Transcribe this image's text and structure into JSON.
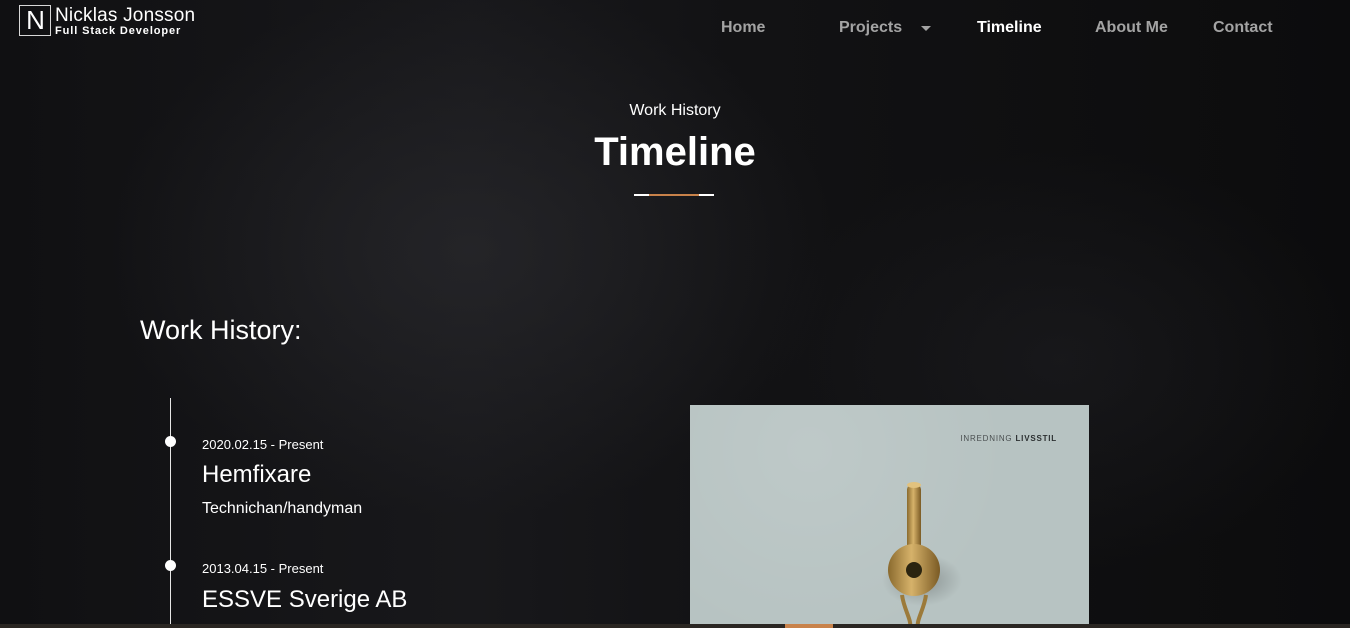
{
  "brand": {
    "logo_letter": "N",
    "name": "Nicklas Jonsson",
    "role": "Full Stack Developer"
  },
  "nav": {
    "items": [
      {
        "label": "Home",
        "active": false
      },
      {
        "label": "Projects",
        "active": false,
        "has_dropdown": true
      },
      {
        "label": "Timeline",
        "active": true
      },
      {
        "label": "About Me",
        "active": false
      },
      {
        "label": "Contact",
        "active": false
      }
    ]
  },
  "hero": {
    "eyebrow": "Work History",
    "title": "Timeline"
  },
  "section": {
    "heading": "Work History:"
  },
  "timeline": [
    {
      "date": "2020.02.15 - Present",
      "company": "Hemfixare",
      "role": "Technichan/handyman"
    },
    {
      "date": "2013.04.15 - Present",
      "company": "ESSVE Sverige AB"
    }
  ],
  "photo": {
    "caption_prefix": "INREDNING",
    "caption_bold": "LIVSSTIL"
  },
  "colors": {
    "accent": "#c8824a",
    "nav_inactive": "#a3a3a3",
    "nav_active": "#ffffff",
    "photo_bg": "#b7c3c2",
    "brass": "#b8954a"
  },
  "icons": {
    "dropdown": "caret-down-icon",
    "timeline_marker": "dot-icon"
  }
}
